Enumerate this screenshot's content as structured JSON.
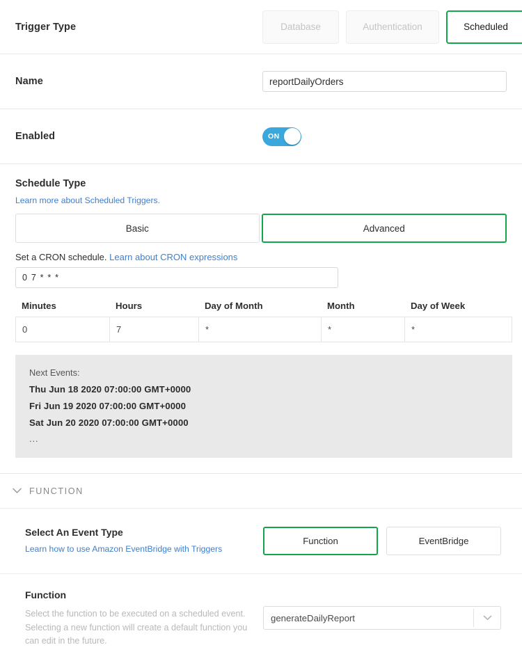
{
  "trigger_type": {
    "label": "Trigger Type",
    "options": [
      {
        "label": "Database",
        "state": "disabled"
      },
      {
        "label": "Authentication",
        "state": "disabled"
      },
      {
        "label": "Scheduled",
        "state": "selected"
      }
    ]
  },
  "name": {
    "label": "Name",
    "value": "reportDailyOrders",
    "placeholder": "Name"
  },
  "enabled": {
    "label": "Enabled",
    "toggle_text": "ON",
    "state": "on"
  },
  "schedule_type": {
    "title": "Schedule Type",
    "help_link": "Learn more about Scheduled Triggers.",
    "options": [
      {
        "label": "Basic",
        "state": "normal"
      },
      {
        "label": "Advanced",
        "state": "selected"
      }
    ],
    "cron_help_text": "Set a CRON schedule.",
    "cron_help_link": "Learn about CRON expressions",
    "cron_value": "0 7 * * *",
    "cron_placeholder": "* * * * *",
    "table": {
      "headers": [
        "Minutes",
        "Hours",
        "Day of Month",
        "Month",
        "Day of Week"
      ],
      "values": [
        "0",
        "7",
        "*",
        "*",
        "*"
      ]
    },
    "next_events": {
      "title": "Next Events:",
      "items": [
        "Thu Jun 18 2020 07:00:00 GMT+0000",
        "Fri Jun 19 2020 07:00:00 GMT+0000",
        "Sat Jun 20 2020 07:00:00 GMT+0000"
      ],
      "ellipsis": "..."
    }
  },
  "function_section": {
    "header_label": "FUNCTION",
    "header_icon": "chevron-down-icon",
    "event_type": {
      "title": "Select An Event Type",
      "help_link": "Learn how to use Amazon EventBridge with Triggers",
      "options": [
        {
          "label": "Function",
          "state": "selected"
        },
        {
          "label": "EventBridge",
          "state": "normal"
        }
      ]
    },
    "function_select": {
      "title": "Function",
      "description": "Select the function to be executed on a scheduled event. Selecting a new function will create a default function you can edit in the future.",
      "value": "generateDailyReport",
      "arrow_icon": "chevron-down-icon"
    }
  },
  "colors": {
    "accent_green": "#13a54a",
    "link_blue": "#3c7fd1",
    "toggle_blue": "#3aa8dd",
    "panel_gray": "#e9e9e9"
  }
}
